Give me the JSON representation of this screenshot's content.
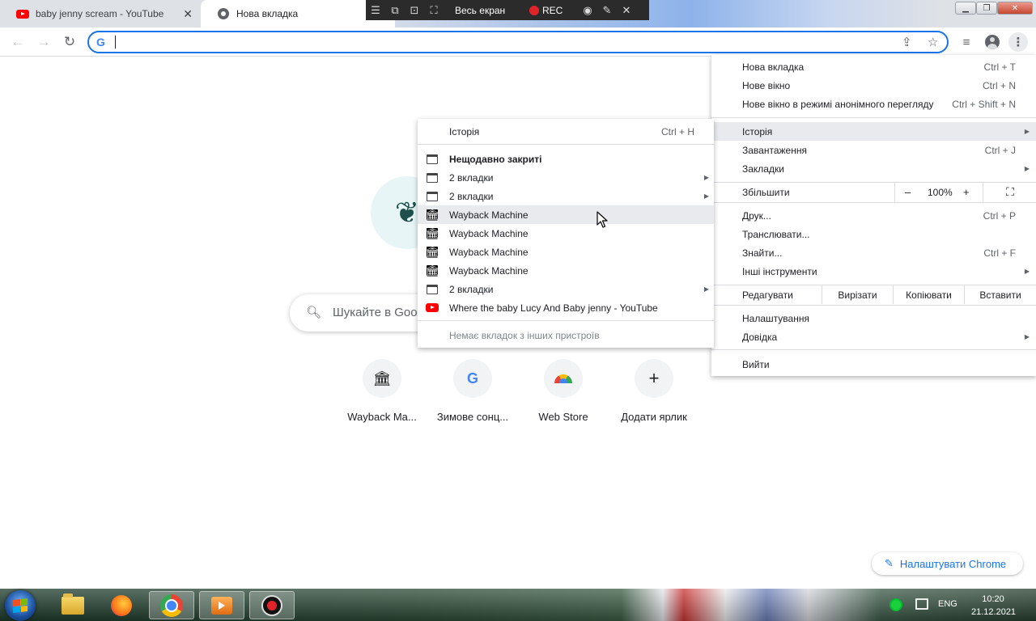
{
  "browser": {
    "tabs": [
      {
        "title": "baby jenny scream - YouTube",
        "icon": "youtube-icon",
        "active": false
      },
      {
        "title": "Нова вкладка",
        "icon": "chrome-icon",
        "active": true
      }
    ],
    "tab_close_glyph": "✕",
    "omnibox": {
      "value": "",
      "placeholder": ""
    }
  },
  "recorder_toolbar": {
    "fullscreen_label": "Весь екран",
    "rec_label": "REC"
  },
  "new_tab_page": {
    "search_placeholder": "Шукайте в Google",
    "shortcuts": [
      {
        "label": "Wayback Ma...",
        "icon": "wayback-icon"
      },
      {
        "label": "Зимове сонц...",
        "icon": "google-icon"
      },
      {
        "label": "Web Store",
        "icon": "web-store-icon"
      },
      {
        "label": "Додати ярлик",
        "icon": "plus-icon"
      }
    ],
    "customize_label": "Налаштувати Chrome"
  },
  "main_menu": {
    "items": [
      {
        "label": "Нова вкладка",
        "shortcut": "Ctrl + T"
      },
      {
        "label": "Нове вікно",
        "shortcut": "Ctrl + N"
      },
      {
        "label": "Нове вікно в режимі анонімного перегляду",
        "shortcut": "Ctrl + Shift + N"
      },
      {
        "label": "Історія",
        "shortcut": "",
        "submenu": true,
        "highlighted": true
      },
      {
        "label": "Завантаження",
        "shortcut": "Ctrl + J"
      },
      {
        "label": "Закладки",
        "shortcut": "",
        "submenu": true
      },
      {
        "label": "Друк...",
        "shortcut": "Ctrl + P"
      },
      {
        "label": "Транслювати...",
        "shortcut": ""
      },
      {
        "label": "Знайти...",
        "shortcut": "Ctrl + F"
      },
      {
        "label": "Інші інструменти",
        "shortcut": "",
        "submenu": true
      },
      {
        "label": "Налаштування",
        "shortcut": ""
      },
      {
        "label": "Довідка",
        "shortcut": "",
        "submenu": true
      },
      {
        "label": "Вийти",
        "shortcut": ""
      }
    ],
    "zoom": {
      "label": "Збільшити",
      "minus": "–",
      "value": "100%",
      "plus": "+"
    },
    "edit": {
      "label": "Редагувати",
      "cut": "Вирізати",
      "copy": "Копіювати",
      "paste": "Вставити"
    }
  },
  "history_menu": {
    "header": {
      "label": "Історія",
      "shortcut": "Ctrl + H"
    },
    "recently_closed": "Нещодавно закриті",
    "items": [
      {
        "label": "2 вкладки",
        "icon": "window-icon",
        "submenu": true
      },
      {
        "label": "2 вкладки",
        "icon": "window-icon",
        "submenu": true
      },
      {
        "label": "Wayback Machine",
        "icon": "wayback-icon",
        "highlighted": true
      },
      {
        "label": "Wayback Machine",
        "icon": "wayback-icon"
      },
      {
        "label": "Wayback Machine",
        "icon": "wayback-icon"
      },
      {
        "label": "Wayback Machine",
        "icon": "wayback-icon"
      },
      {
        "label": "2 вкладки",
        "icon": "window-icon",
        "submenu": true
      },
      {
        "label": "Where the baby Lucy And Baby jenny - YouTube",
        "icon": "youtube-icon"
      }
    ],
    "no_other_devices": "Немає вкладок з інших пристроїв"
  },
  "taskbar": {
    "apps": [
      "explorer",
      "firefox",
      "chrome",
      "media-player",
      "screen-recorder"
    ],
    "active_app": "chrome",
    "language": "ENG",
    "time": "10:20",
    "date": "21.12.2021"
  },
  "colors": {
    "accent": "#1a73e8",
    "tab_strip": "#dee1e6",
    "menu_highlight": "#e8eaed",
    "rec_red": "#e0242a"
  }
}
